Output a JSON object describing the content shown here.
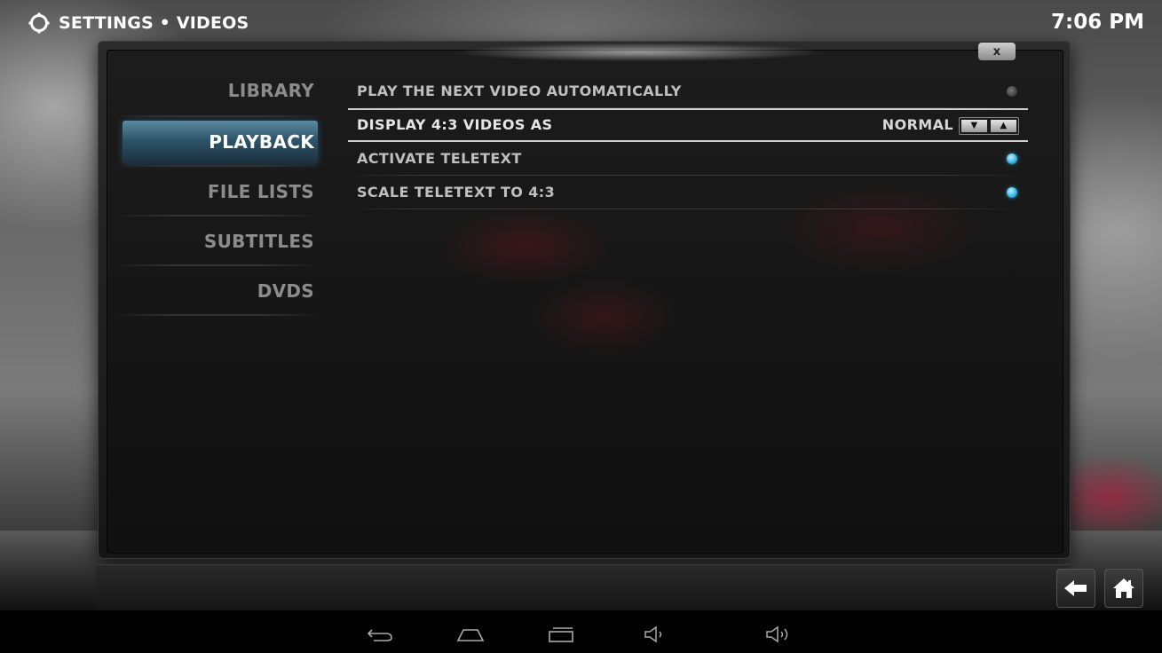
{
  "header": {
    "title": "SETTINGS • VIDEOS",
    "clock": "7:06 PM",
    "icon": "gear-icon"
  },
  "dialog": {
    "close_label": "x"
  },
  "categories": [
    {
      "label": "LIBRARY",
      "active": false
    },
    {
      "label": "PLAYBACK",
      "active": true
    },
    {
      "label": "FILE LISTS",
      "active": false
    },
    {
      "label": "SUBTITLES",
      "active": false
    },
    {
      "label": "DVDS",
      "active": false
    }
  ],
  "settings": [
    {
      "label": "PLAY THE NEXT VIDEO AUTOMATICALLY",
      "type": "toggle",
      "enabled": false
    },
    {
      "label": "DISPLAY 4:3 VIDEOS AS",
      "type": "select",
      "value": "NORMAL",
      "focused": true
    },
    {
      "label": "ACTIVATE TELETEXT",
      "type": "toggle",
      "enabled": true
    },
    {
      "label": "SCALE TELETEXT TO 4:3",
      "type": "toggle",
      "enabled": true
    }
  ],
  "nav_buttons": {
    "back_icon": "back-arrow-icon",
    "home_icon": "home-icon"
  },
  "system_bar": [
    "back-icon",
    "home-icon",
    "recent-apps-icon",
    "volume-down-icon",
    "volume-up-icon"
  ],
  "colors": {
    "accent": "#39b7e6",
    "highlight": "#2f5469"
  }
}
